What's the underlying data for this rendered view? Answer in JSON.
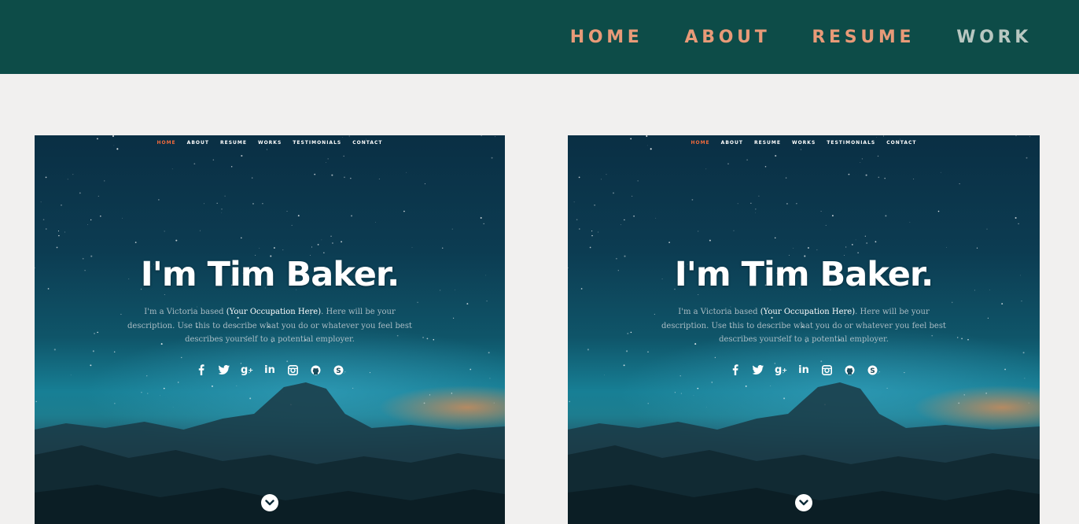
{
  "topnav": {
    "items": [
      {
        "label": "HOME"
      },
      {
        "label": "ABOUT"
      },
      {
        "label": "RESUME"
      },
      {
        "label": "WORK"
      }
    ],
    "current": "WORK"
  },
  "previews": [
    {
      "nav": [
        "HOME",
        "ABOUT",
        "RESUME",
        "WORKS",
        "TESTIMONIALS",
        "CONTACT"
      ],
      "nav_active": "HOME",
      "title": "I'm Tim Baker.",
      "desc_pre": "I'm a Victoria based ",
      "desc_occupation": "(Your Occupation Here)",
      "desc_post": ". Here will be your description. Use this to describe what you do or whatever you feel best describes yourself to a potential employer.",
      "social_icons": [
        "facebook-icon",
        "twitter-icon",
        "google-plus-icon",
        "linkedin-icon",
        "instagram-icon",
        "github-icon",
        "skype-icon"
      ]
    },
    {
      "nav": [
        "HOME",
        "ABOUT",
        "RESUME",
        "WORKS",
        "TESTIMONIALS",
        "CONTACT"
      ],
      "nav_active": "HOME",
      "title": "I'm Tim Baker.",
      "desc_pre": "I'm a Victoria based ",
      "desc_occupation": "(Your Occupation Here)",
      "desc_post": ". Here will be your description. Use this to describe what you do or whatever you feel best describes yourself to a potential employer.",
      "social_icons": [
        "facebook-icon",
        "twitter-icon",
        "google-plus-icon",
        "linkedin-icon",
        "instagram-icon",
        "github-icon",
        "skype-icon"
      ]
    }
  ],
  "colors": {
    "header_bg": "#0d4c48",
    "nav_link": "#e89a78",
    "nav_current": "#b8c7c1",
    "page_bg": "#f1f0ef",
    "mini_nav_active": "#f06a3c"
  }
}
